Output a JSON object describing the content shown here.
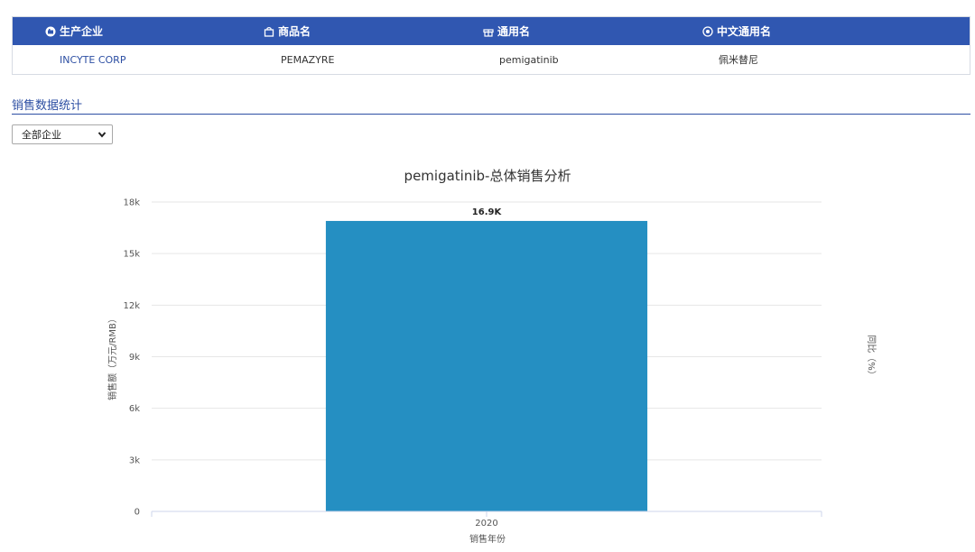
{
  "info_table": {
    "headers": [
      {
        "label": "生产企业",
        "icon": "factory-icon"
      },
      {
        "label": "商品名",
        "icon": "bag-icon"
      },
      {
        "label": "通用名",
        "icon": "gift-icon"
      },
      {
        "label": "中文通用名",
        "icon": "target-icon"
      }
    ],
    "row": [
      "INCYTE CORP",
      "PEMAZYRE",
      "pemigatinib",
      "佩米替尼"
    ]
  },
  "section": {
    "title": "销售数据统计"
  },
  "filter": {
    "selected": "全部企业",
    "icon": "chevron-down-icon"
  },
  "colors": {
    "header_bg": "#3057b1",
    "accent": "#2d4fa3",
    "bar": "#258fc2"
  },
  "chart_data": {
    "type": "bar",
    "title": "pemigatinib-总体销售分析",
    "categories": [
      "2020"
    ],
    "values": [
      16900
    ],
    "data_labels": [
      "16.9K"
    ],
    "xlabel": "销售年份",
    "ylabel": "销售额（万元/RMB）",
    "y2label": "同比（%）",
    "ylim": [
      0,
      18000
    ],
    "yticks": [
      {
        "value": 0,
        "label": "0"
      },
      {
        "value": 3000,
        "label": "3k"
      },
      {
        "value": 6000,
        "label": "6k"
      },
      {
        "value": 9000,
        "label": "9k"
      },
      {
        "value": 12000,
        "label": "12k"
      },
      {
        "value": 15000,
        "label": "15k"
      },
      {
        "value": 18000,
        "label": "18k"
      }
    ],
    "grid": true
  }
}
